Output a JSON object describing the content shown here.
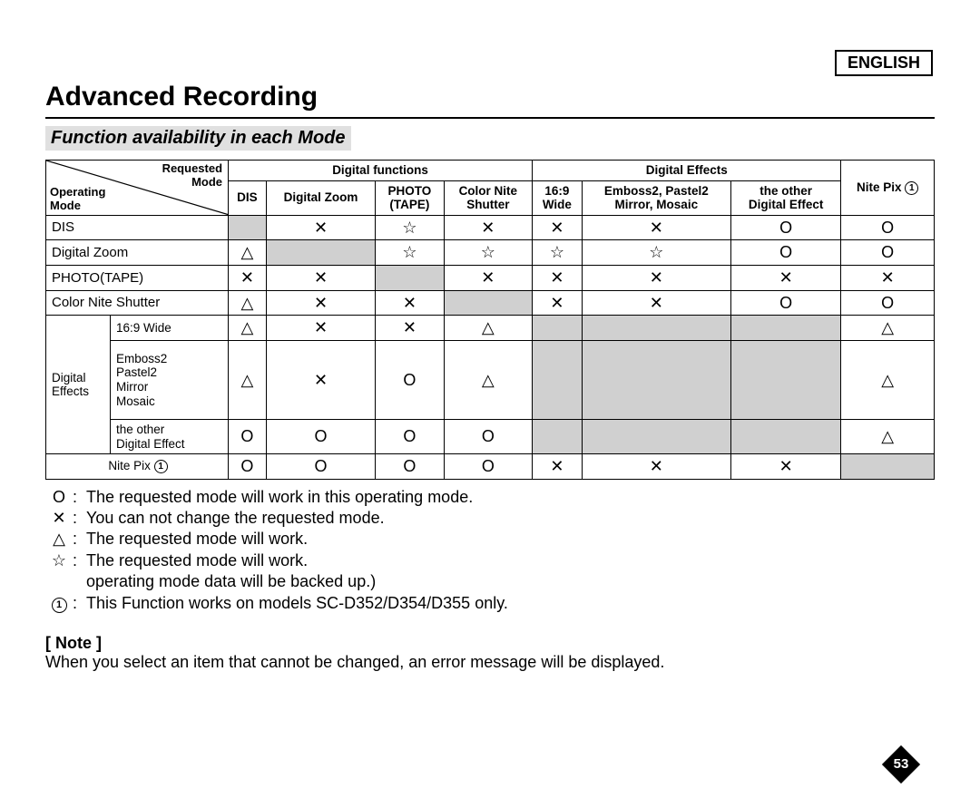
{
  "language": "ENGLISH",
  "title": "Advanced Recording",
  "subtitle": "Function availability in each Mode",
  "header": {
    "diag_requested": "Requested",
    "diag_mode1": "Mode",
    "diag_operating": "Operating",
    "diag_mode2": "Mode",
    "group_digital_functions": "Digital functions",
    "group_digital_effects": "Digital Effects",
    "nite_pix": "Nite Pix",
    "col_dis": "DIS",
    "col_dzoom": "Digital Zoom",
    "col_photo_a": "PHOTO",
    "col_photo_b": "(TAPE)",
    "col_cns_a": "Color Nite",
    "col_cns_b": "Shutter",
    "col_169_a": "16:9",
    "col_169_b": "Wide",
    "col_emb_a": "Emboss2, Pastel2",
    "col_emb_b": "Mirror, Mosaic",
    "col_oth_a": "the other",
    "col_oth_b": "Digital Effect"
  },
  "rows": {
    "dis": "DIS",
    "dzoom": "Digital Zoom",
    "phototape": "PHOTO(TAPE)",
    "cns": "Color Nite Shutter",
    "de_group": "Digital Effects",
    "de_169": "16:9 Wide",
    "de_embp_a": "Emboss2",
    "de_embp_b": "Pastel2",
    "de_embp_c": "Mirror",
    "de_embp_d": "Mosaic",
    "de_other_a": "the other",
    "de_other_b": "Digital Effect",
    "nitepix": "Nite Pix"
  },
  "cells": {
    "dis": [
      "",
      "✕",
      "☆",
      "✕",
      "✕",
      "✕",
      "O",
      "O"
    ],
    "dzoom": [
      "△",
      "",
      "☆",
      "☆",
      "☆",
      "☆",
      "O",
      "O"
    ],
    "photo": [
      "✕",
      "✕",
      "",
      "✕",
      "✕",
      "✕",
      "✕",
      "✕"
    ],
    "cns": [
      "△",
      "✕",
      "✕",
      "",
      "✕",
      "✕",
      "O",
      "O"
    ],
    "de_169": [
      "△",
      "✕",
      "✕",
      "△",
      "",
      "",
      "",
      "△"
    ],
    "de_emb": [
      "△",
      "✕",
      "O",
      "△",
      "",
      "",
      "",
      "△"
    ],
    "de_other": [
      "O",
      "O",
      "O",
      "O",
      "",
      "",
      "",
      "△"
    ],
    "nitepix": [
      "O",
      "O",
      "O",
      "O",
      "✕",
      "✕",
      "✕",
      ""
    ]
  },
  "legend": {
    "o": "The requested mode will work in this operating mode.",
    "x": "You can not change the requested mode.",
    "tri": "The requested mode will work.",
    "star": "The requested mode will work.",
    "star2": "operating mode data will be backed up.)",
    "one": "This Function works on models SC-D352/D354/D355 only."
  },
  "note_head": "[ Note ]",
  "note_text": "When you select an item that cannot be changed, an error message will be displayed.",
  "page_number": "53"
}
